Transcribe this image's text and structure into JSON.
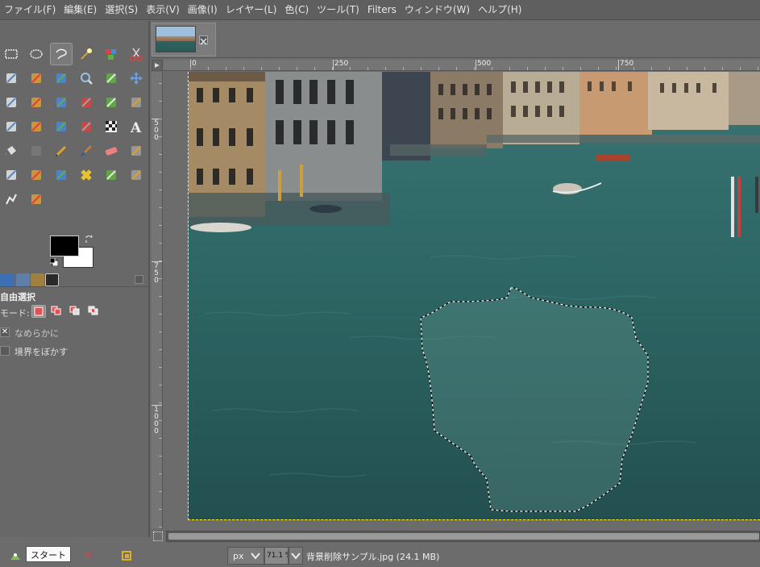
{
  "menubar": {
    "items": [
      "ファイル(F)",
      "編集(E)",
      "選択(S)",
      "表示(V)",
      "画像(I)",
      "レイヤー(L)",
      "色(C)",
      "ツール(T)",
      "Filters",
      "ウィンドウ(W)",
      "ヘルプ(H)"
    ]
  },
  "toolbox": {
    "tools": [
      "rect-select-icon",
      "ellipse-select-icon",
      "free-select-icon",
      "fuzzy-select-icon",
      "color-select-icon",
      "scissors-select-icon",
      "foreground-select-icon",
      "paths-icon",
      "color-picker-icon",
      "zoom-icon",
      "measure-icon",
      "move-icon",
      "align-icon",
      "crop-icon",
      "unified-transform-icon",
      "rotate-icon",
      "scale-icon",
      "shear-icon",
      "cage-transform-icon",
      "perspective-icon",
      "flip-icon",
      "warp-icon",
      "checker-icon",
      "text-icon",
      "bucket-fill-icon",
      "blend-icon",
      "pencil-icon",
      "paintbrush-icon",
      "eraser-icon",
      "airbrush-icon",
      "ink-icon",
      "mypaint-icon",
      "clone-icon",
      "heal-icon",
      "perspective-clone-icon",
      "blur-sharpen-icon",
      "smudge-icon",
      "dodge-burn-icon"
    ],
    "active_tool_index": 2,
    "colors": {
      "foreground": "#000000",
      "background": "#ffffff"
    }
  },
  "tool_options": {
    "title": "自由選択",
    "mode_label": "モード:",
    "antialias_label": "なめらかに",
    "antialias_checked": true,
    "feather_label": "境界をぼかす",
    "feather_checked": false
  },
  "image_tabs": [
    {
      "name": "背景削除サンプル.jpg"
    }
  ],
  "rulers": {
    "h_labels": [
      "0",
      "250",
      "500",
      "750"
    ],
    "v_labels": [
      "500",
      "750",
      "1000"
    ]
  },
  "statusbar": {
    "unit": "px",
    "zoom": "71.1 %",
    "text": "背景削除サンプル.jpg (24.1 MB)"
  },
  "taskbar": {
    "start_label": "スタート"
  }
}
